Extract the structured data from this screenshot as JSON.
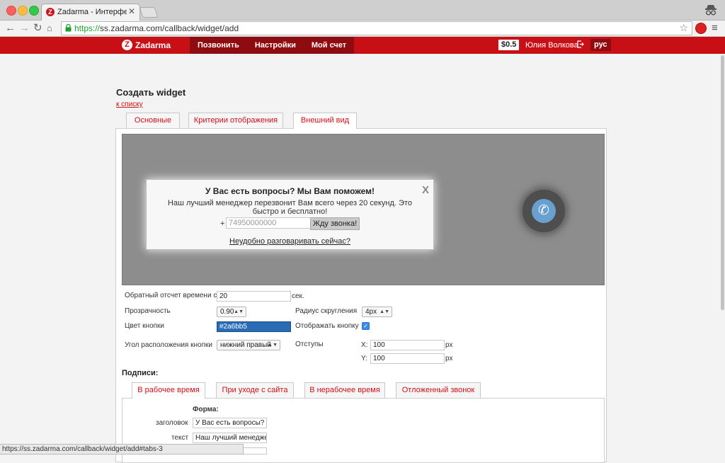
{
  "browser": {
    "tab_title": "Zadarma - Интерфейс пол",
    "url_scheme": "https://",
    "url_rest": "ss.zadarma.com/callback/widget/add",
    "status_url": "https://ss.zadarma.com/callback/widget/add#tabs-3"
  },
  "header": {
    "logo": "Zadarma",
    "nav": [
      "Позвонить",
      "Настройки",
      "Мой счет"
    ],
    "balance": "$0.5",
    "user": "Юлия Волкова",
    "lang": "рус"
  },
  "page": {
    "title": "Создать widget",
    "back_link": "к списку",
    "tabs": [
      "Основные",
      "Критерии отображения",
      "Внешний вид"
    ],
    "active_tab": 2
  },
  "preview": {
    "title": "У Вас есть вопросы? Мы Вам поможем!",
    "close": "X",
    "text": "Наш лучший менеджер перезвонит Вам всего через 20 секунд. Это быстро и бесплатно!",
    "plus": "+",
    "phone_placeholder": "74950000000",
    "button": "Жду звонка!",
    "link": "Неудобно разговаривать сейчас?"
  },
  "settings": {
    "countdown_label": "Обратный отсчет времени с",
    "countdown_value": "20",
    "countdown_unit": "сек.",
    "opacity_label": "Прозрачность",
    "opacity_value": "0.90",
    "radius_label": "Радиус скругления",
    "radius_value": "4px",
    "color_label": "Цвет кнопки",
    "color_value": "#2a6bb5",
    "show_button_label": "Отображать кнопку",
    "show_button_checked": true,
    "corner_label": "Угол расположения кнопки",
    "corner_value": "нижний правый",
    "offsets_label": "Отступы",
    "x_label": "X:",
    "x_value": "100",
    "x_unit": "px",
    "y_label": "Y:",
    "y_value": "100",
    "y_unit": "px"
  },
  "captions": {
    "title": "Подписи:",
    "tabs": [
      "В рабочее время",
      "При уходе с сайта",
      "В нерабочее время",
      "Отложенный звонок"
    ],
    "active_tab": 0,
    "form_title": "Форма:",
    "header_label": "заголовок",
    "header_value": "У Вас есть вопросы? Мы",
    "text_label": "текст",
    "text_value": "Наш лучший менеджер"
  },
  "colors": {
    "brand": "#c80f16",
    "brand_dark": "#8e0b10",
    "button_color": "#2a6bb5"
  }
}
